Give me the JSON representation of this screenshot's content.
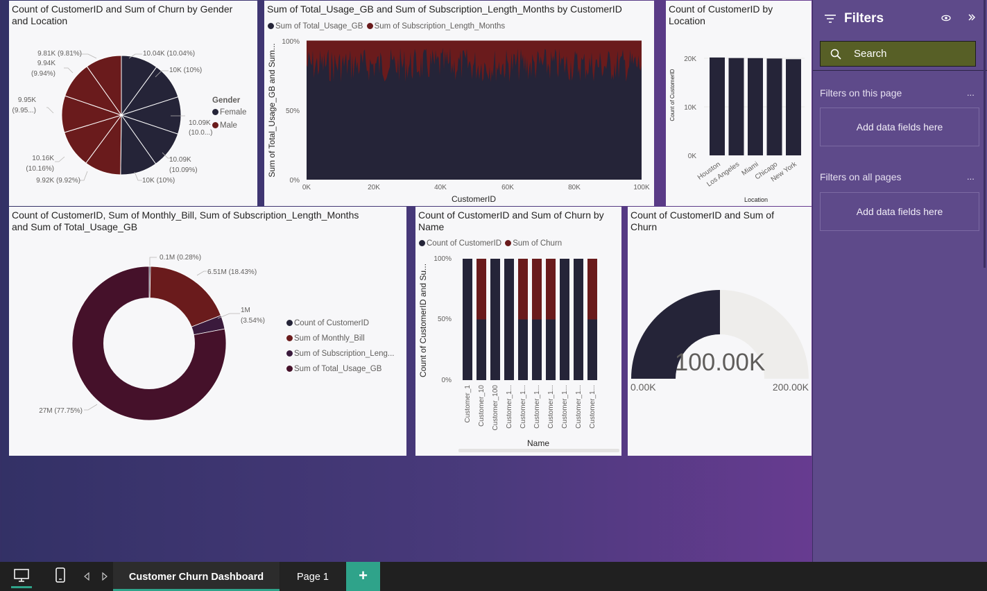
{
  "visuals": {
    "gender_location_pie": {
      "title_line1": "Count of CustomerID and Sum of Churn by Gender",
      "title_line2": "and Location",
      "legend_title": "Gender",
      "legend": [
        "Female",
        "Male"
      ],
      "labels": {
        "l1": "10.04K (10.04%)",
        "l2": "10K (10%)",
        "l3a": "10.09K",
        "l3b": "(10.0...)",
        "l4a": "10.09K",
        "l4b": "(10.09%)",
        "l5": "10K (10%)",
        "l6": "9.92K (9.92%)",
        "l7a": "10.16K",
        "l7b": "(10.16%)",
        "l8a": "9.95K",
        "l8b": "(9.95...)",
        "l9a": "9.94K",
        "l9b": "(9.94%)",
        "l10": "9.81K (9.81%)"
      }
    },
    "usage_area": {
      "title": "Sum of Total_Usage_GB and Sum of Subscription_Length_Months by CustomerID",
      "legend": [
        "Sum of Total_Usage_GB",
        "Sum of Subscription_Length_Months"
      ],
      "ylabel": "Sum of Total_Usage_GB and Sum...",
      "xlabel": "CustomerID",
      "yticks": [
        "100%",
        "50%",
        "0%"
      ],
      "xticks": [
        "0K",
        "20K",
        "40K",
        "60K",
        "80K",
        "100K"
      ]
    },
    "location_bar": {
      "title_line1": "Count of CustomerID by",
      "title_line2": "Location",
      "ylabel": "Count of CustomerID",
      "xlabel": "Location",
      "yticks": [
        "20K",
        "10K",
        "0K"
      ]
    },
    "totals_donut": {
      "title_line1": "Count of CustomerID, Sum of Monthly_Bill, Sum of Subscription_Length_Months",
      "title_line2": "and Sum of Total_Usage_GB",
      "legend": [
        "Count of CustomerID",
        "Sum of Monthly_Bill",
        "Sum of Subscription_Leng...",
        "Sum of Total_Usage_GB"
      ],
      "labels": {
        "count": "0.1M (0.28%)",
        "bill": "6.51M (18.43%)",
        "sub_a": "1M",
        "sub_b": "(3.54%)",
        "usage": "27M (77.75%)"
      }
    },
    "name_bar": {
      "title_line1": "Count of CustomerID and Sum of Churn by",
      "title_line2": "Name",
      "legend": [
        "Count of CustomerID",
        "Sum of Churn"
      ],
      "ylabel": "Count of CustomerID and Su...",
      "xlabel": "Name",
      "yticks": [
        "100%",
        "50%",
        "0%"
      ],
      "categories": [
        "Customer_1",
        "Customer_10",
        "Customer_100",
        "Customer_1...",
        "Customer_1...",
        "Customer_1...",
        "Customer_1...",
        "Customer_1...",
        "Customer_1...",
        "Customer_1..."
      ]
    },
    "gauge": {
      "title_line1": "Count of CustomerID and Sum of",
      "title_line2": "Churn",
      "value_label": "100.00K",
      "min_label": "0.00K",
      "max_label": "200.00K"
    }
  },
  "chart_data": [
    {
      "type": "pie",
      "title": "Count of CustomerID and Sum of Churn by Gender and Location",
      "legend_title": "Gender",
      "series": [
        {
          "name": "Female",
          "color": "#252438"
        },
        {
          "name": "Male",
          "color": "#6a1b1c"
        }
      ],
      "slices": [
        {
          "gender": "Female",
          "value": 10040,
          "percent": 10.04
        },
        {
          "gender": "Female",
          "value": 10000,
          "percent": 10.0
        },
        {
          "gender": "Female",
          "value": 10090,
          "percent": 10.09
        },
        {
          "gender": "Female",
          "value": 10090,
          "percent": 10.09
        },
        {
          "gender": "Female",
          "value": 10000,
          "percent": 10.0
        },
        {
          "gender": "Male",
          "value": 9920,
          "percent": 9.92
        },
        {
          "gender": "Male",
          "value": 10160,
          "percent": 10.16
        },
        {
          "gender": "Male",
          "value": 9950,
          "percent": 9.95
        },
        {
          "gender": "Male",
          "value": 9940,
          "percent": 9.94
        },
        {
          "gender": "Male",
          "value": 9810,
          "percent": 9.81
        }
      ],
      "legend_position": "right"
    },
    {
      "type": "area",
      "title": "Sum of Total_Usage_GB and Sum of Subscription_Length_Months by CustomerID",
      "stacking": "100%",
      "xlabel": "CustomerID",
      "ylabel": "Sum of Total_Usage_GB and Sum...",
      "xlim": [
        0,
        100000
      ],
      "ylim": [
        0,
        100
      ],
      "series": [
        {
          "name": "Sum of Total_Usage_GB",
          "color": "#252438",
          "approx_share_percent": [
            70,
            95
          ]
        },
        {
          "name": "Sum of Subscription_Length_Months",
          "color": "#6a1b1c",
          "approx_share_percent": [
            5,
            30
          ]
        }
      ],
      "legend_position": "top-left"
    },
    {
      "type": "bar",
      "title": "Count of CustomerID by Location",
      "categories": [
        "Houston",
        "Los Angeles",
        "Miami",
        "Chicago",
        "New York"
      ],
      "values": [
        20160,
        20050,
        20030,
        19950,
        19810
      ],
      "xlabel": "Location",
      "ylabel": "Count of CustomerID",
      "ylim": [
        0,
        20000
      ]
    },
    {
      "type": "pie",
      "subtype": "donut",
      "title": "Count of CustomerID, Sum of Monthly_Bill, Sum of Subscription_Length_Months and Sum of Total_Usage_GB",
      "categories": [
        "Count of CustomerID",
        "Sum of Monthly_Bill",
        "Sum of Subscription_Length_Months",
        "Sum of Total_Usage_GB"
      ],
      "values": [
        100000,
        6510000,
        1000000,
        27000000
      ],
      "percent": [
        0.28,
        18.43,
        3.54,
        77.75
      ],
      "colors": [
        "#252438",
        "#6a1b1c",
        "#3a1a3c",
        "#45112a"
      ],
      "legend_position": "right"
    },
    {
      "type": "bar",
      "stacking": "100%",
      "title": "Count of CustomerID and Sum of Churn by Name",
      "categories": [
        "Customer_1",
        "Customer_10",
        "Customer_100",
        "Customer_1...",
        "Customer_1...",
        "Customer_1...",
        "Customer_1...",
        "Customer_1...",
        "Customer_1...",
        "Customer_1..."
      ],
      "series": [
        {
          "name": "Count of CustomerID",
          "values": [
            1,
            1,
            1,
            1,
            1,
            1,
            1,
            1,
            1,
            1
          ]
        },
        {
          "name": "Sum of Churn",
          "values": [
            0,
            1,
            0,
            0,
            1,
            1,
            1,
            0,
            0,
            1
          ]
        }
      ],
      "xlabel": "Name",
      "ylabel": "Count of CustomerID and Su...",
      "ylim": [
        0,
        100
      ]
    },
    {
      "type": "gauge",
      "title": "Count of CustomerID and Sum of Churn",
      "value": 100000,
      "min": 0,
      "max": 200000
    }
  ],
  "filters": {
    "title": "Filters",
    "search_placeholder": "Search",
    "on_this_page": "Filters on this page",
    "on_all_pages": "Filters on all pages",
    "add_fields": "Add data fields here",
    "dots": "..."
  },
  "bottom_bar": {
    "tabs": [
      "Customer Churn Dashboard",
      "Page 1"
    ],
    "active_tab": "Customer Churn Dashboard",
    "add_label": "+"
  },
  "colors": {
    "dark_navy": "#252438",
    "maroon": "#6a1b1c",
    "accent_green": "#2fa38a",
    "filter_pane": "#5e4a8a"
  }
}
